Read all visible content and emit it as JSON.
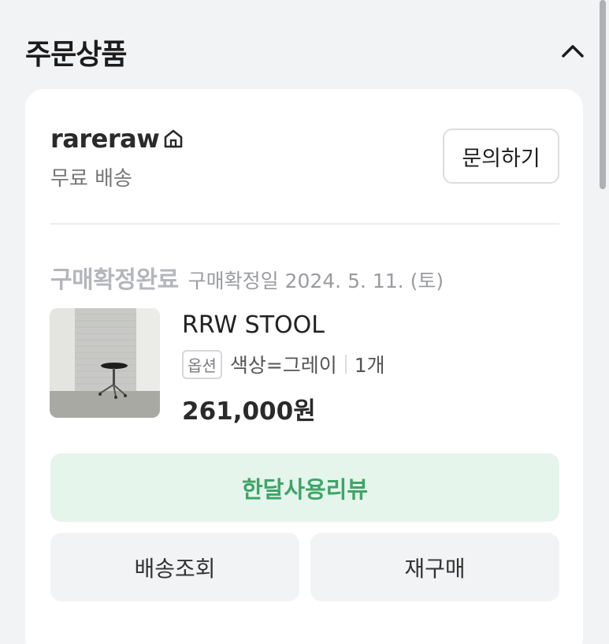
{
  "section": {
    "title": "주문상품"
  },
  "shop": {
    "name": "rareraw",
    "shipping": "무료 배송",
    "inquiry_label": "문의하기"
  },
  "order": {
    "status": "구매확정완료",
    "confirm_date": "구매확정일 2024. 5. 11. (토)"
  },
  "product": {
    "name": "RRW STOOL",
    "option_badge": "옵션",
    "option_text": "색상=그레이",
    "quantity": "1개",
    "price": "261,000원"
  },
  "actions": {
    "review_label": "한달사용리뷰",
    "track_label": "배송조회",
    "rebuy_label": "재구매"
  },
  "colors": {
    "accent_green": "#3ea568",
    "review_bg": "#e5f5ec"
  },
  "icons": {
    "collapse": "chevron-up-icon",
    "shop_home": "home-icon"
  }
}
